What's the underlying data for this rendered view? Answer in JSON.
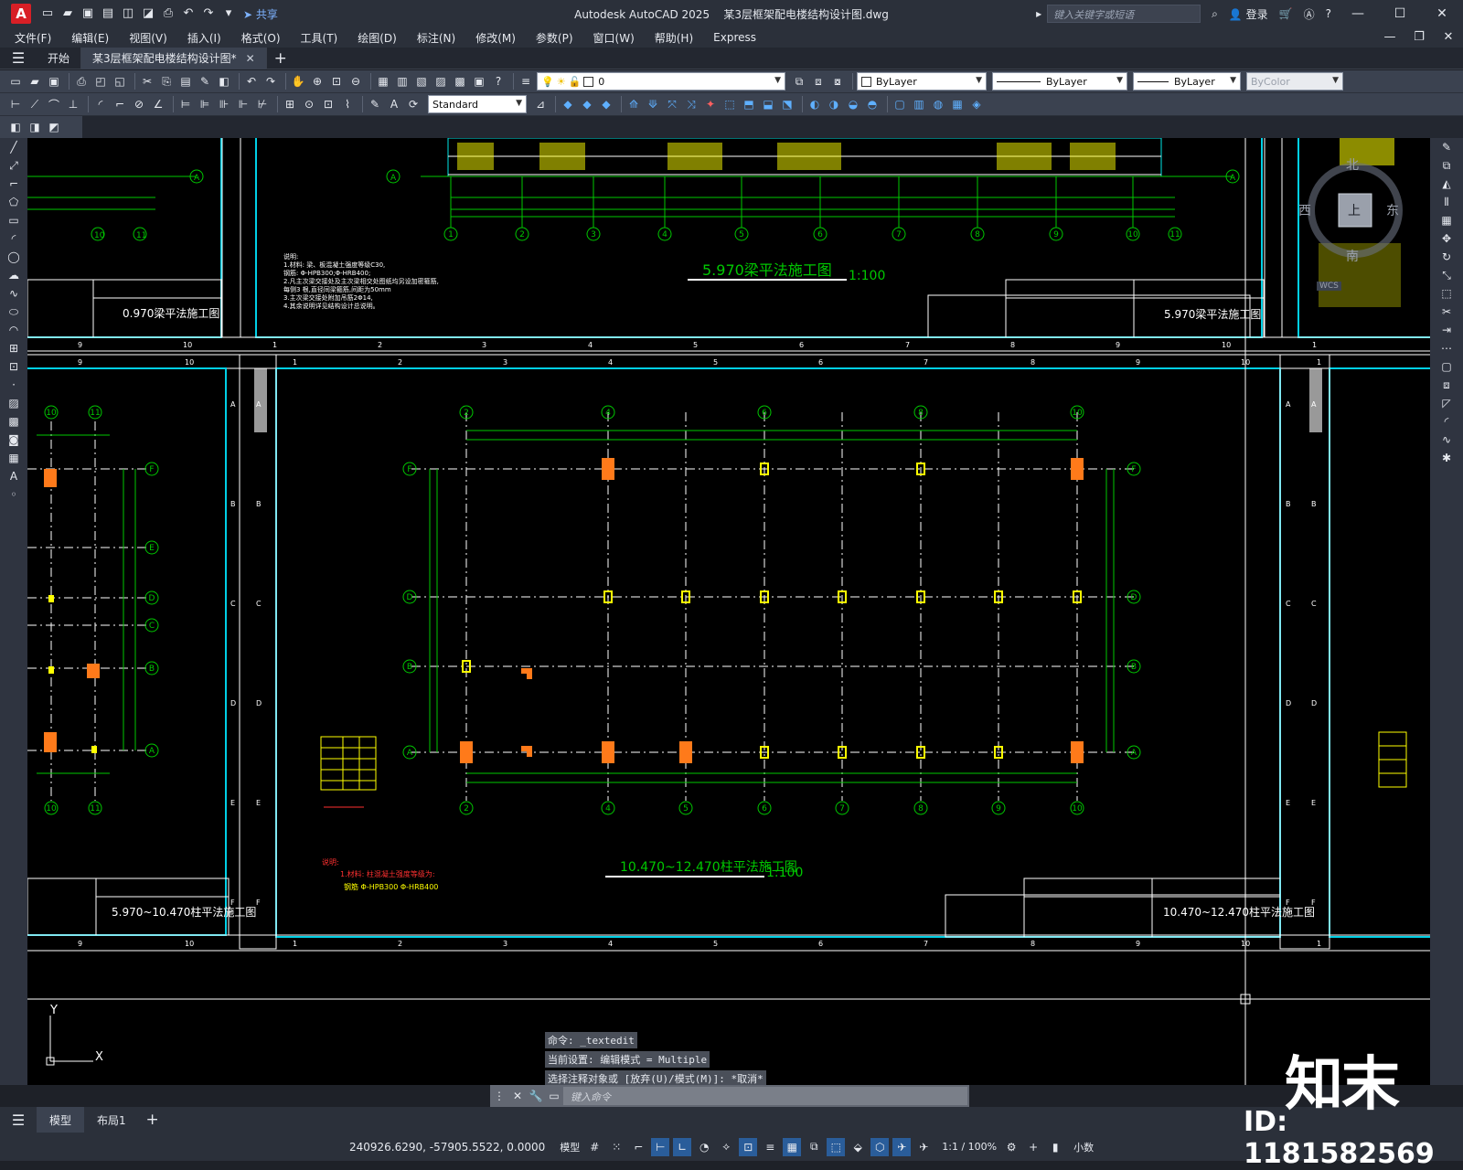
{
  "app": {
    "logo": "A",
    "title": "Autodesk AutoCAD 2025",
    "filename": "某3层框架配电楼结构设计图.dwg",
    "share_label": "共享",
    "search_placeholder": "键入关键字或短语",
    "login_label": "登录"
  },
  "menu": [
    "文件(F)",
    "编辑(E)",
    "视图(V)",
    "插入(I)",
    "格式(O)",
    "工具(T)",
    "绘图(D)",
    "标注(N)",
    "修改(M)",
    "参数(P)",
    "窗口(W)",
    "帮助(H)",
    "Express"
  ],
  "tabs": {
    "start": "开始",
    "doc": "某3层框架配电楼结构设计图*"
  },
  "properties": {
    "layer": "0",
    "color": "ByLayer",
    "linetype": "ByLayer",
    "lineweight": "ByLayer",
    "plotstyle": "ByColor",
    "textstyle": "Standard"
  },
  "drawing": {
    "top_left_title": "0.970梁平法施工图",
    "top_center_title": "5.970梁平法施工图",
    "top_center_scale": "1:100",
    "top_right_title": "5.970梁平法施工图",
    "mid_center_title": "10.470~12.470柱平法施工图",
    "mid_center_scale": "1:100",
    "mid_center_titleblock": "10.470~12.470柱平法施工图",
    "mid_left_titleblock": "5.970~10.470柱平法施工图",
    "notes_header": "说明:",
    "notes_line1": "1.材料: 柱混凝土强度等级为:",
    "notes_line2": "钢筋 Φ-HPB300  Φ-HRB400",
    "top_notes": [
      "说明:",
      "1.材料: 梁、板混凝土强度等级C30,",
      "钢筋: Φ-HPB300;Φ-HRB400;",
      "2.凡主次梁交接处及主次梁相交处图纸均另设加密箍筋,",
      "每侧3 根,直径同梁箍筋,间距为50mm",
      "3.主次梁交接处附加吊筋2Φ14,",
      "4.其余说明详见结构设计总说明。"
    ],
    "grid_top": [
      "1",
      "2",
      "3",
      "4",
      "5",
      "6",
      "7",
      "8",
      "9",
      "10"
    ],
    "ruler_top": [
      "9",
      "10",
      "1",
      "2",
      "3",
      "4",
      "5",
      "6",
      "7",
      "8",
      "9",
      "10",
      "1"
    ],
    "ruler_side": [
      "A",
      "B",
      "C",
      "D",
      "E",
      "F"
    ],
    "col_bubbles_top": [
      "2",
      "4",
      "6",
      "8",
      "10"
    ],
    "col_bubbles_bottom": [
      "2",
      "4",
      "5",
      "6",
      "7",
      "8",
      "9",
      "10"
    ],
    "row_bubbles": [
      "F",
      "D",
      "B",
      "A"
    ],
    "left_row_bubbles": [
      "F",
      "E",
      "D",
      "C",
      "B",
      "A"
    ],
    "left_col_bubbles": [
      "10",
      "11"
    ]
  },
  "viewcube": {
    "north": "北",
    "south": "南",
    "east": "东",
    "west": "西",
    "top": "上",
    "wcs": "WCS"
  },
  "commands": {
    "line1": "命令: _textedit",
    "line2": "当前设置: 编辑模式 = Multiple",
    "line3": "选择注释对象或 [放弃(U)/模式(M)]: *取消*",
    "placeholder": "键入命令"
  },
  "layout_tabs": [
    "模型",
    "布局1"
  ],
  "status": {
    "coords": "240926.6290, -57905.5522, 0.0000",
    "model": "模型",
    "scale": "1:1 / 100%",
    "units": "小数"
  },
  "watermark": {
    "logo": "知末",
    "id": "ID: 1181582569"
  },
  "colors": {
    "frame": "#00d0e6",
    "grid_line": "#00c800",
    "annotation": "#ffff00",
    "column": "#ff7a1a",
    "background": "#000000"
  }
}
